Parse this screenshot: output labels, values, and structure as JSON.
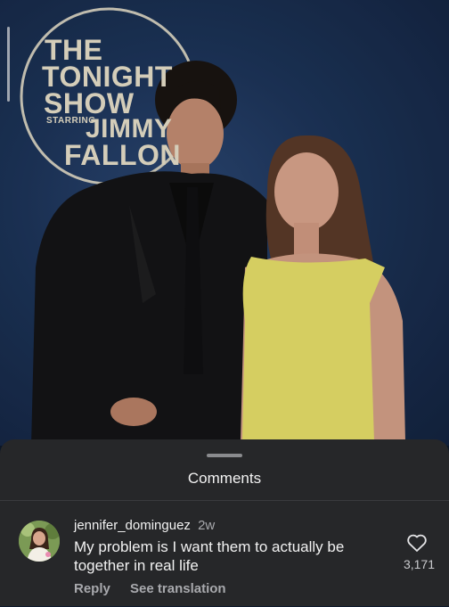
{
  "photo": {
    "logo": {
      "line1": "THE",
      "line2": "TONIGHT",
      "line3": "SHOW",
      "line4": "STARRING",
      "line5": "JIMMY",
      "line6": "FALLON"
    }
  },
  "comments_sheet": {
    "title": "Comments",
    "comments": [
      {
        "username": "jennifer_dominguez",
        "time": "2w",
        "text": "My problem is I want them to actually be together in real life",
        "like_count": "3,171",
        "reply_label": "Reply",
        "translate_label": "See translation"
      }
    ]
  },
  "colors": {
    "sheet_bg": "#262729",
    "photo_bg": "#1c3357",
    "yellow_dress": "#e8e06a"
  }
}
